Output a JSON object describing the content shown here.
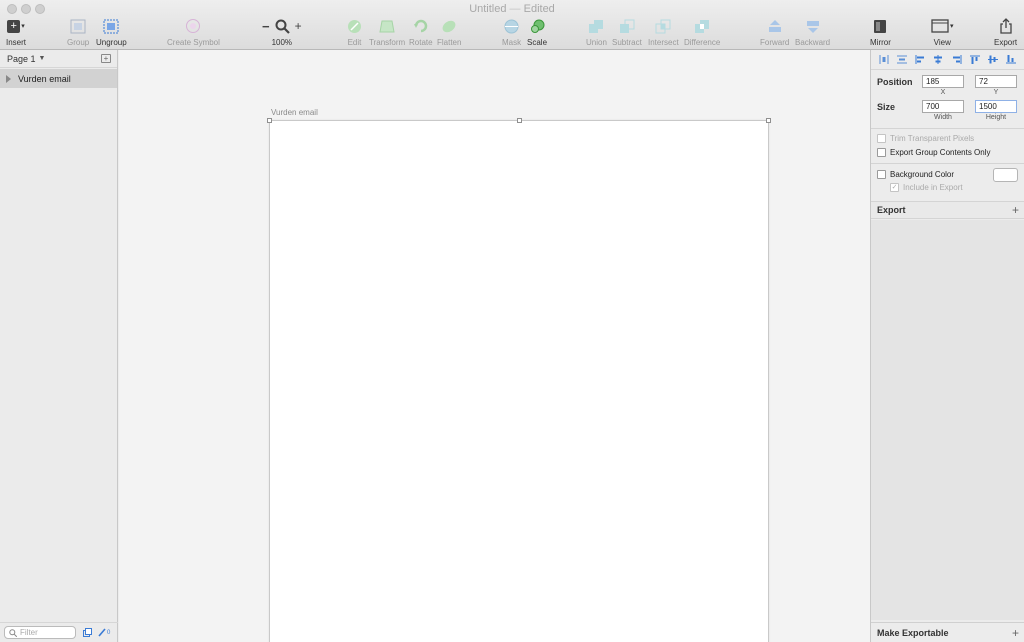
{
  "window": {
    "title": "Untitled",
    "separator": "—",
    "status": "Edited"
  },
  "toolbar": {
    "insert": "Insert",
    "group": "Group",
    "ungroup": "Ungroup",
    "create_symbol": "Create Symbol",
    "zoom_minus": "−",
    "zoom_plus": "+",
    "zoom_level": "100%",
    "edit": "Edit",
    "transform": "Transform",
    "rotate": "Rotate",
    "flatten": "Flatten",
    "mask": "Mask",
    "scale": "Scale",
    "union": "Union",
    "subtract": "Subtract",
    "intersect": "Intersect",
    "difference": "Difference",
    "forward": "Forward",
    "backward": "Backward",
    "mirror": "Mirror",
    "view": "View",
    "export": "Export"
  },
  "layers": {
    "page": "Page 1",
    "items": [
      {
        "label": "Vurden email"
      }
    ],
    "filter_placeholder": "Filter",
    "slice_count": "0"
  },
  "canvas": {
    "artboard_label": "Vurden email"
  },
  "inspector": {
    "position_label": "Position",
    "x_value": "185",
    "y_value": "72",
    "x_label": "X",
    "y_label": "Y",
    "size_label": "Size",
    "width_value": "700",
    "height_value": "1500",
    "width_label": "Width",
    "height_label": "Height",
    "trim_label": "Trim Transparent Pixels",
    "export_group_label": "Export Group Contents Only",
    "bg_color_label": "Background Color",
    "include_export_label": "Include in Export",
    "export_header": "Export",
    "make_exportable": "Make Exportable"
  },
  "colors": {
    "accent": "#3a7bd5",
    "artboard": "#ffffff",
    "canvas": "#f3f3f3"
  }
}
